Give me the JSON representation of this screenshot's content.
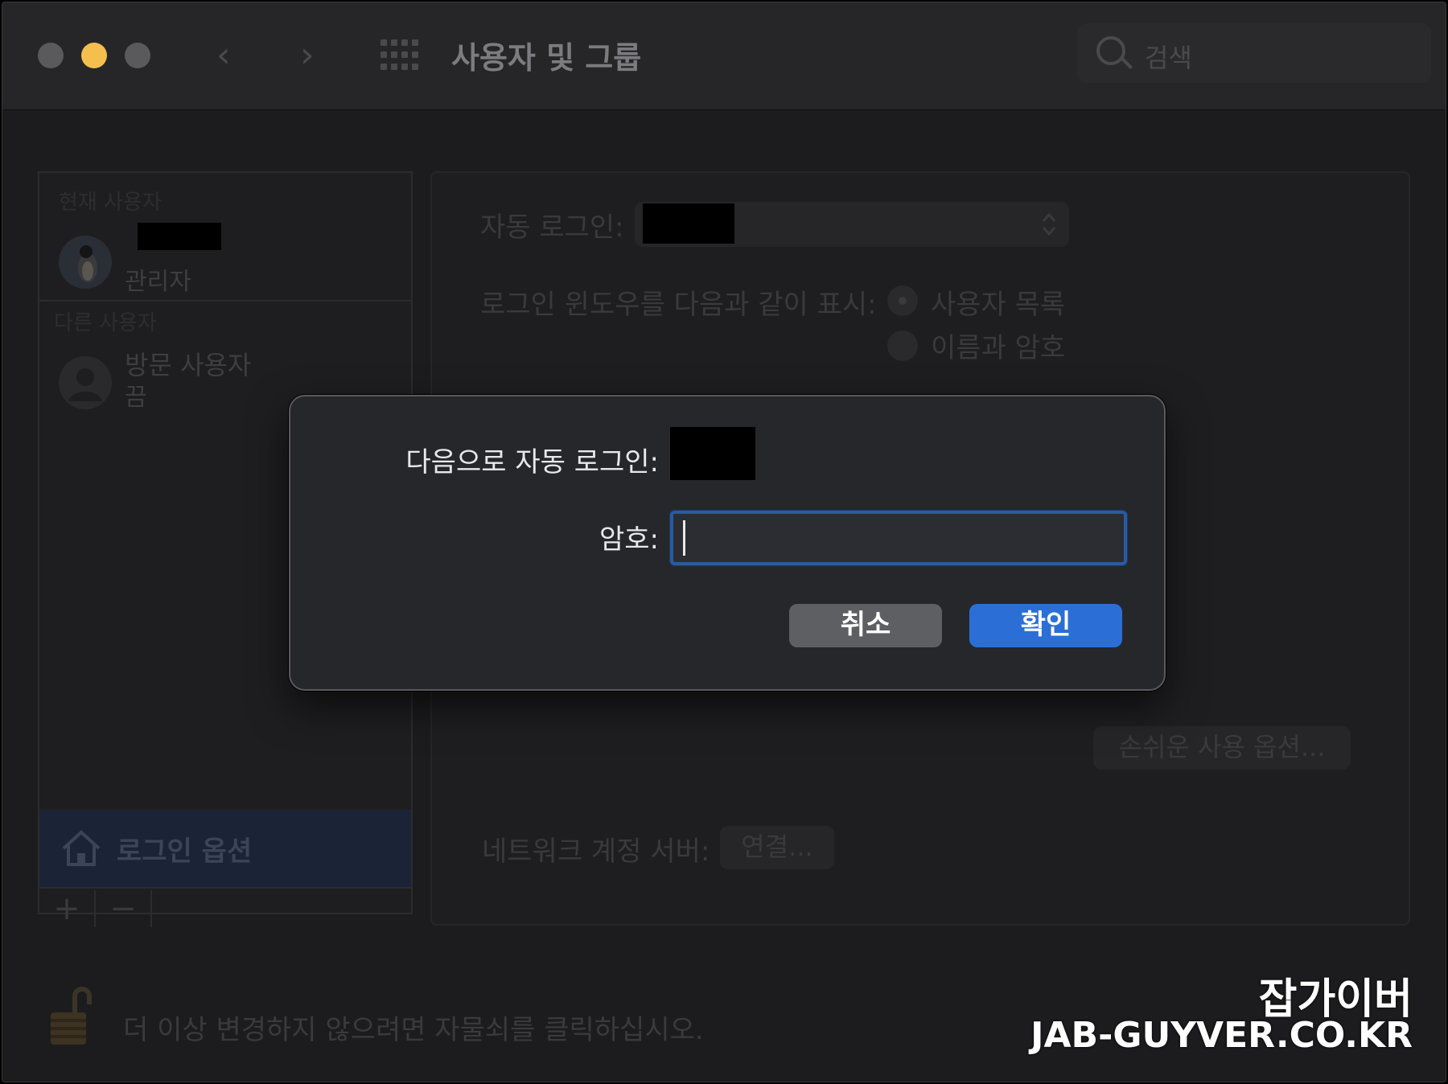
{
  "window": {
    "title": "사용자 및 그룹",
    "nav_back": "‹",
    "nav_forward": "›",
    "search_placeholder": "검색"
  },
  "sidebar": {
    "current_users_label": "현재 사용자",
    "current_user_role": "관리자",
    "other_users_label": "다른 사용자",
    "guest_name": "방문 사용자",
    "guest_status": "끔",
    "login_options_label": "로그인 옵션",
    "add": "+",
    "remove": "−"
  },
  "main": {
    "auto_login_label": "자동 로그인:",
    "login_window_label": "로그인 윈도우를 다음과 같이 표시:",
    "radio_user_list": "사용자 목록",
    "radio_name_password": "이름과 암호",
    "accessibility_button": "손쉬운 사용 옵션...",
    "network_server_label": "네트워크 계정 서버:",
    "connect_button": "연결..."
  },
  "footer": {
    "lock_text": "더 이상 변경하지 않으려면 자물쇠를 클릭하십시오."
  },
  "dialog": {
    "auto_login_as_label": "다음으로 자동 로그인:",
    "password_label": "암호:",
    "password_value": "",
    "cancel_label": "취소",
    "ok_label": "확인"
  },
  "watermark": {
    "line1": "잡가이버",
    "line2": "JAB-GUYVER.CO.KR"
  },
  "colors": {
    "accent": "#2b6fd6",
    "traffic_yellow": "#f4bf4f"
  }
}
